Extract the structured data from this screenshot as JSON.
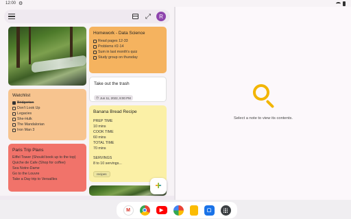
{
  "status_bar": {
    "time": "12:00",
    "icons": [
      "gear-icon",
      "wifi-icon",
      "battery-icon"
    ]
  },
  "search_bar": {
    "avatar_letter": "R"
  },
  "notes": {
    "homework": {
      "title": "Homework - Data Science",
      "items": [
        {
          "text": "Read pages 12-33",
          "checked": false
        },
        {
          "text": "Problems #2-14",
          "checked": false
        },
        {
          "text": "Sum in last month's quiz",
          "checked": false
        },
        {
          "text": "Study group on thursday",
          "checked": false
        }
      ]
    },
    "trash": {
      "title": "Take out the trash",
      "reminder": "Jun 11, 2022, 8:00 PM"
    },
    "watchlist": {
      "title": "Watchlist",
      "items": [
        {
          "text": "Bridgerton",
          "checked": true
        },
        {
          "text": "Don't Look Up",
          "checked": false
        },
        {
          "text": "Legacies",
          "checked": false
        },
        {
          "text": "She-Hulk",
          "checked": false
        },
        {
          "text": "The Mandalorian",
          "checked": false
        },
        {
          "text": "Iron Man 3",
          "checked": false
        }
      ]
    },
    "banana": {
      "title": "Banana Bread Recipe",
      "lines": [
        "PREP TIME",
        "10 mins",
        "COOK TIME",
        "60 mins",
        "TOTAL TIME",
        "70 mins",
        "",
        "SERVINGS",
        "8 to 10 servings..."
      ],
      "label": "recipes"
    },
    "paris": {
      "title": "Paris Trip Plans",
      "lines": [
        "Eiffel Tower (Should book up to the top)",
        "Quiche de Cafe (Shop for coffee)",
        "Sea Notre-Dame",
        "Go to the Louvre",
        "Take a Day trip to Versailles"
      ]
    }
  },
  "empty_state": {
    "text": "Select a note to view its contents."
  },
  "colors": {
    "accent_yellow": "#f2b500",
    "note_orange": "#f7c48f",
    "note_red": "#f1736a",
    "note_yellow": "#fbf0a6"
  },
  "dock_apps": [
    "Gmail",
    "Chrome",
    "YouTube",
    "Photos",
    "Keep",
    "Messages",
    "App launcher"
  ]
}
